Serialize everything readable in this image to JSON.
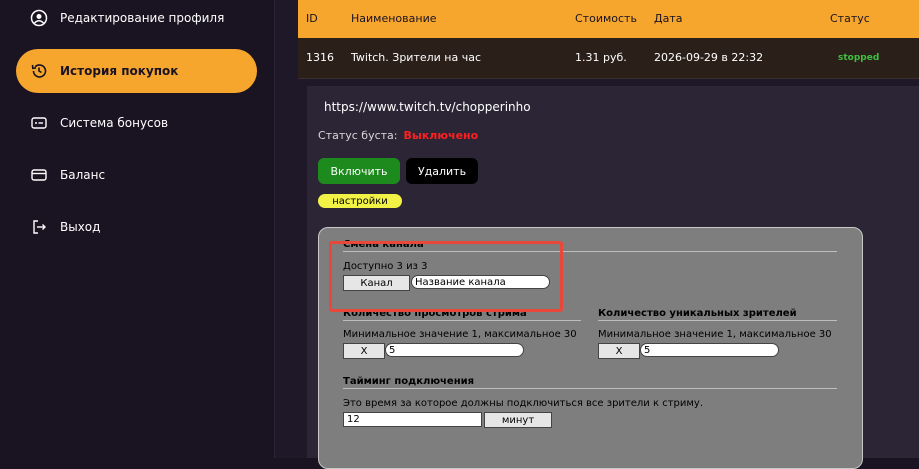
{
  "sidebar": {
    "items": [
      {
        "label": "Редактирование профиля",
        "icon": "user-circle-icon"
      },
      {
        "label": "История покупок",
        "icon": "history-icon",
        "active": true
      },
      {
        "label": "Система бонусов",
        "icon": "bonus-card-icon"
      },
      {
        "label": "Баланс",
        "icon": "wallet-icon"
      },
      {
        "label": "Выход",
        "icon": "logout-icon"
      }
    ]
  },
  "table": {
    "headers": {
      "id": "ID",
      "name": "Наименование",
      "price": "Стоимость",
      "date": "Дата",
      "status": "Статус"
    },
    "row": {
      "id": "1316",
      "name": "Twitch. Зрители на час",
      "price": "1.31 руб.",
      "date": "2026-09-29 в 22:32",
      "status": "stopped"
    }
  },
  "details": {
    "url": "https://www.twitch.tv/chopperinho",
    "boost_label": "Статус буста:",
    "boost_value": "Выключено",
    "enable_label": "Включить",
    "delete_label": "Удалить",
    "settings_label": "настройки"
  },
  "settings": {
    "channel": {
      "title": "Смена канала",
      "available": "Доступно 3 из 3",
      "button": "Канал",
      "input_value": "Название канала"
    },
    "views": {
      "title": "Количество просмотров стрима",
      "hint": "Минимальное значение 1, максимальное 30",
      "x": "X",
      "value": "5"
    },
    "unique": {
      "title": "Количество уникальных зрителей",
      "hint": "Минимальное значение 1, максимальное 30",
      "x": "X",
      "value": "5"
    },
    "timing": {
      "title": "Тайминг подключения",
      "hint": "Это время за которое должны подключиться все зрители к стриму.",
      "value": "12",
      "unit": "минут"
    }
  },
  "colors": {
    "accent": "#f7a62d",
    "background": "#1a1322",
    "status_stopped": "#3fbf3f",
    "boost_off": "#ff1f1f",
    "enable_button": "#1d8a1d",
    "settings_pill": "#f2f246",
    "highlight": "#e8483a"
  }
}
